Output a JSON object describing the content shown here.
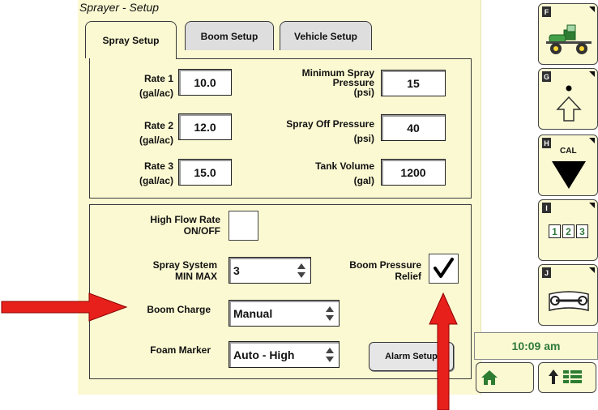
{
  "title": "Sprayer - Setup",
  "tabs": [
    "Spray Setup",
    "Boom Setup",
    "Vehicle Setup"
  ],
  "rates": {
    "rate1_label": "Rate 1",
    "rate1_unit": "(gal/ac)",
    "rate1_value": "10.0",
    "rate2_label": "Rate 2",
    "rate2_unit": "(gal/ac)",
    "rate2_value": "12.0",
    "rate3_label": "Rate 3",
    "rate3_unit": "(gal/ac)",
    "rate3_value": "15.0"
  },
  "pressures": {
    "min_label_1": "Minimum Spray",
    "min_label_2": "Pressure",
    "min_unit": "(psi)",
    "min_value": "15",
    "off_label": "Spray Off Pressure",
    "off_unit": "(psi)",
    "off_value": "40",
    "tank_label": "Tank Volume",
    "tank_unit": "(gal)",
    "tank_value": "1200"
  },
  "options": {
    "high_flow_1": "High Flow Rate",
    "high_flow_2": "ON/OFF",
    "high_flow_checked": false,
    "spray_system_1": "Spray System",
    "spray_system_2": "MIN MAX",
    "spray_system_value": "3",
    "boom_pressure_1": "Boom Pressure",
    "boom_pressure_2": "Relief",
    "boom_pressure_checked": true,
    "boom_charge_label": "Boom Charge",
    "boom_charge_value": "Manual",
    "foam_marker_label": "Foam Marker",
    "foam_marker_value": "Auto - High",
    "alarm_button": "Alarm Setup"
  },
  "softkeys": {
    "f_key": "F",
    "g_key": "G",
    "h_key": "H",
    "h_label": "CAL",
    "i_key": "I",
    "i_digits": [
      "1",
      "2",
      "3"
    ],
    "j_key": "J"
  },
  "status": {
    "time": "10:09 am"
  },
  "colors": {
    "background": "#fbf9d2",
    "arrow": "#e8201b",
    "clock_text": "#2f7a3c"
  }
}
